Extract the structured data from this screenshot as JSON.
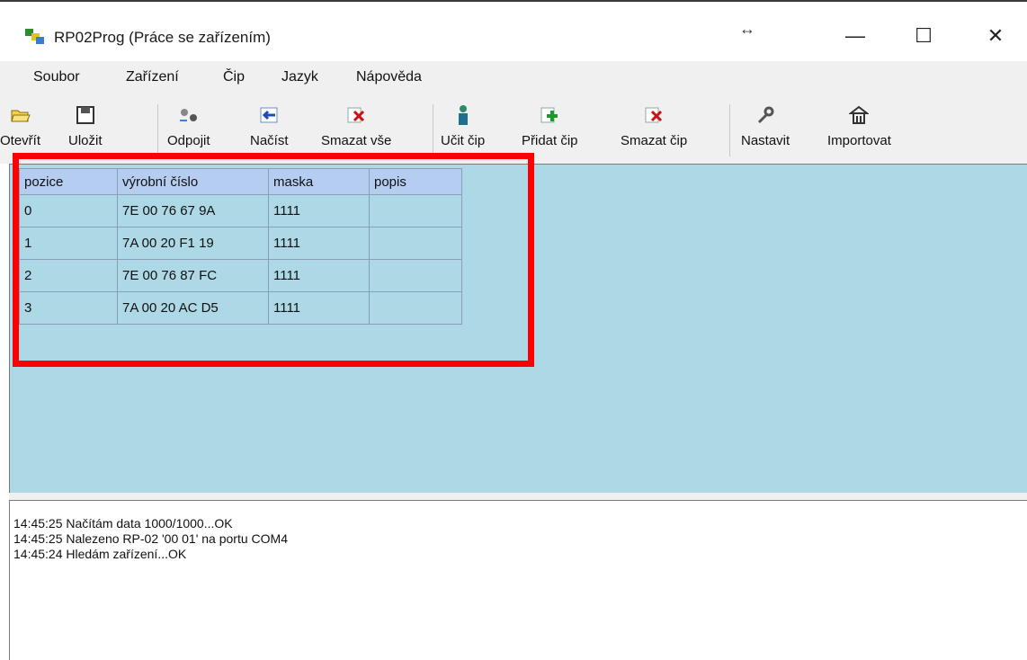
{
  "window": {
    "title": "RP02Prog (Práce se zařízením)",
    "resize_glyph": "↔",
    "minimize_glyph": "—",
    "maximize_glyph": "☐",
    "close_glyph": "✕"
  },
  "menu": {
    "items": [
      "Soubor",
      "Zařízení",
      "Čip",
      "Jazyk",
      "Nápověda"
    ]
  },
  "toolbar": {
    "buttons": [
      {
        "label": "Otevřít",
        "icon": "open-folder-icon"
      },
      {
        "label": "Uložit",
        "icon": "save-floppy-icon"
      },
      {
        "label": "Odpojit",
        "icon": "disconnect-icon"
      },
      {
        "label": "Načíst",
        "icon": "load-arrow-icon"
      },
      {
        "label": "Smazat vše",
        "icon": "delete-all-icon"
      },
      {
        "label": "Učit čip",
        "icon": "teach-chip-icon"
      },
      {
        "label": "Přidat čip",
        "icon": "add-chip-icon"
      },
      {
        "label": "Smazat čip",
        "icon": "delete-chip-icon"
      },
      {
        "label": "Nastavit",
        "icon": "settings-wrench-icon"
      },
      {
        "label": "Importovat",
        "icon": "import-icon"
      }
    ]
  },
  "grid": {
    "columns": [
      "pozice",
      "výrobní číslo",
      "maska",
      "popis"
    ],
    "rows": [
      [
        "0",
        "7E 00 76 67 9A",
        "1111",
        ""
      ],
      [
        "1",
        "7A 00 20 F1 19",
        "1111",
        ""
      ],
      [
        "2",
        "7E 00 76 87 FC",
        "1111",
        ""
      ],
      [
        "3",
        "7A 00 20 AC D5",
        "1111",
        ""
      ]
    ]
  },
  "log": {
    "lines": [
      "14:45:25  Načítám data 1000/1000...OK",
      "14:45:25  Nalezeno RP-02 '00 01' na portu COM4",
      "14:45:24  Hledám zařízení...OK"
    ]
  },
  "colors": {
    "grid_background": "#add8e6",
    "header_background": "#b4cdf0",
    "highlight_border": "#ff0000"
  }
}
